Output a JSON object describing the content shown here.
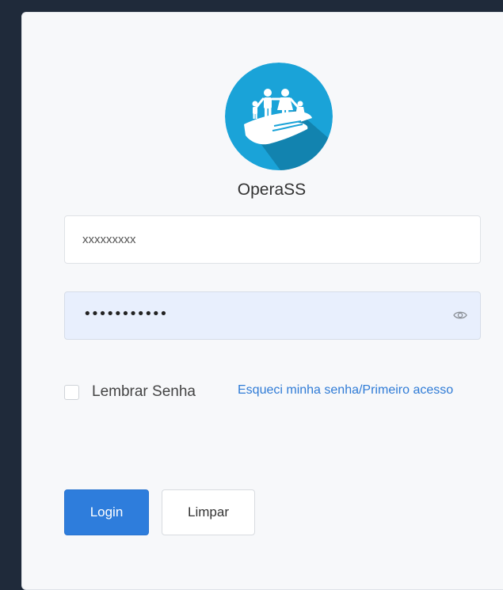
{
  "app": {
    "name": "OperaSS"
  },
  "login_form": {
    "username_value": "xxxxxxxxx",
    "password_dots": "•••••••••••",
    "remember_label": "Lembrar Senha",
    "forgot_link": "Esqueci minha senha/Primeiro acesso",
    "login_button": "Login",
    "clear_button": "Limpar"
  },
  "colors": {
    "page_background": "#1f2a3a",
    "card_background": "#f7f8fa",
    "primary": "#2e7ddc",
    "link": "#2f7bd6",
    "logo_circle": "#1aa3d8",
    "password_field_bg": "#e8effd"
  },
  "icons": {
    "logo": "family-hand-icon",
    "password_toggle": "eye-icon"
  }
}
